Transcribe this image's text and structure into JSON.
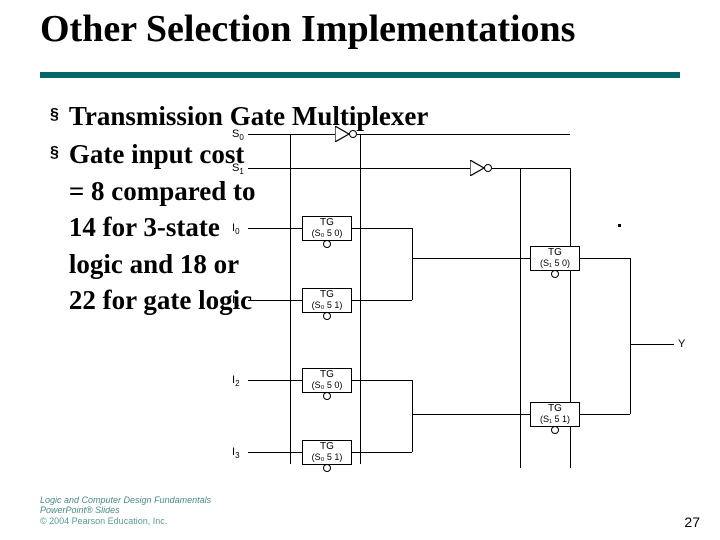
{
  "title": "Other Selection Implementations",
  "bullets": {
    "b1": "Transmission Gate Multiplexer",
    "b2": "Gate input cost = 8 compared to 14 for 3-state logic and 18 or 22 for gate logic"
  },
  "diagram": {
    "signals": {
      "s0": "S",
      "s0_sub": "0",
      "s1": "S",
      "s1_sub": "1",
      "i0": "I",
      "i0_sub": "0",
      "i1": "I",
      "i1_sub": "1",
      "i2": "I",
      "i2_sub": "2",
      "i3": "I",
      "i3_sub": "3",
      "y": "Y"
    },
    "tg": {
      "title": "TG",
      "c_s0_0": "(S₀ 5 0)",
      "c_s0_1": "(S₀ 5 1)",
      "c_s1_0": "(S₁ 5 0)",
      "c_s1_1": "(S₁ 5 1)"
    }
  },
  "footer": {
    "l1": "Logic and Computer Design Fundamentals",
    "l2": "PowerPoint® Slides",
    "l3": "© 2004 Pearson Education, Inc."
  },
  "page_number": "27"
}
